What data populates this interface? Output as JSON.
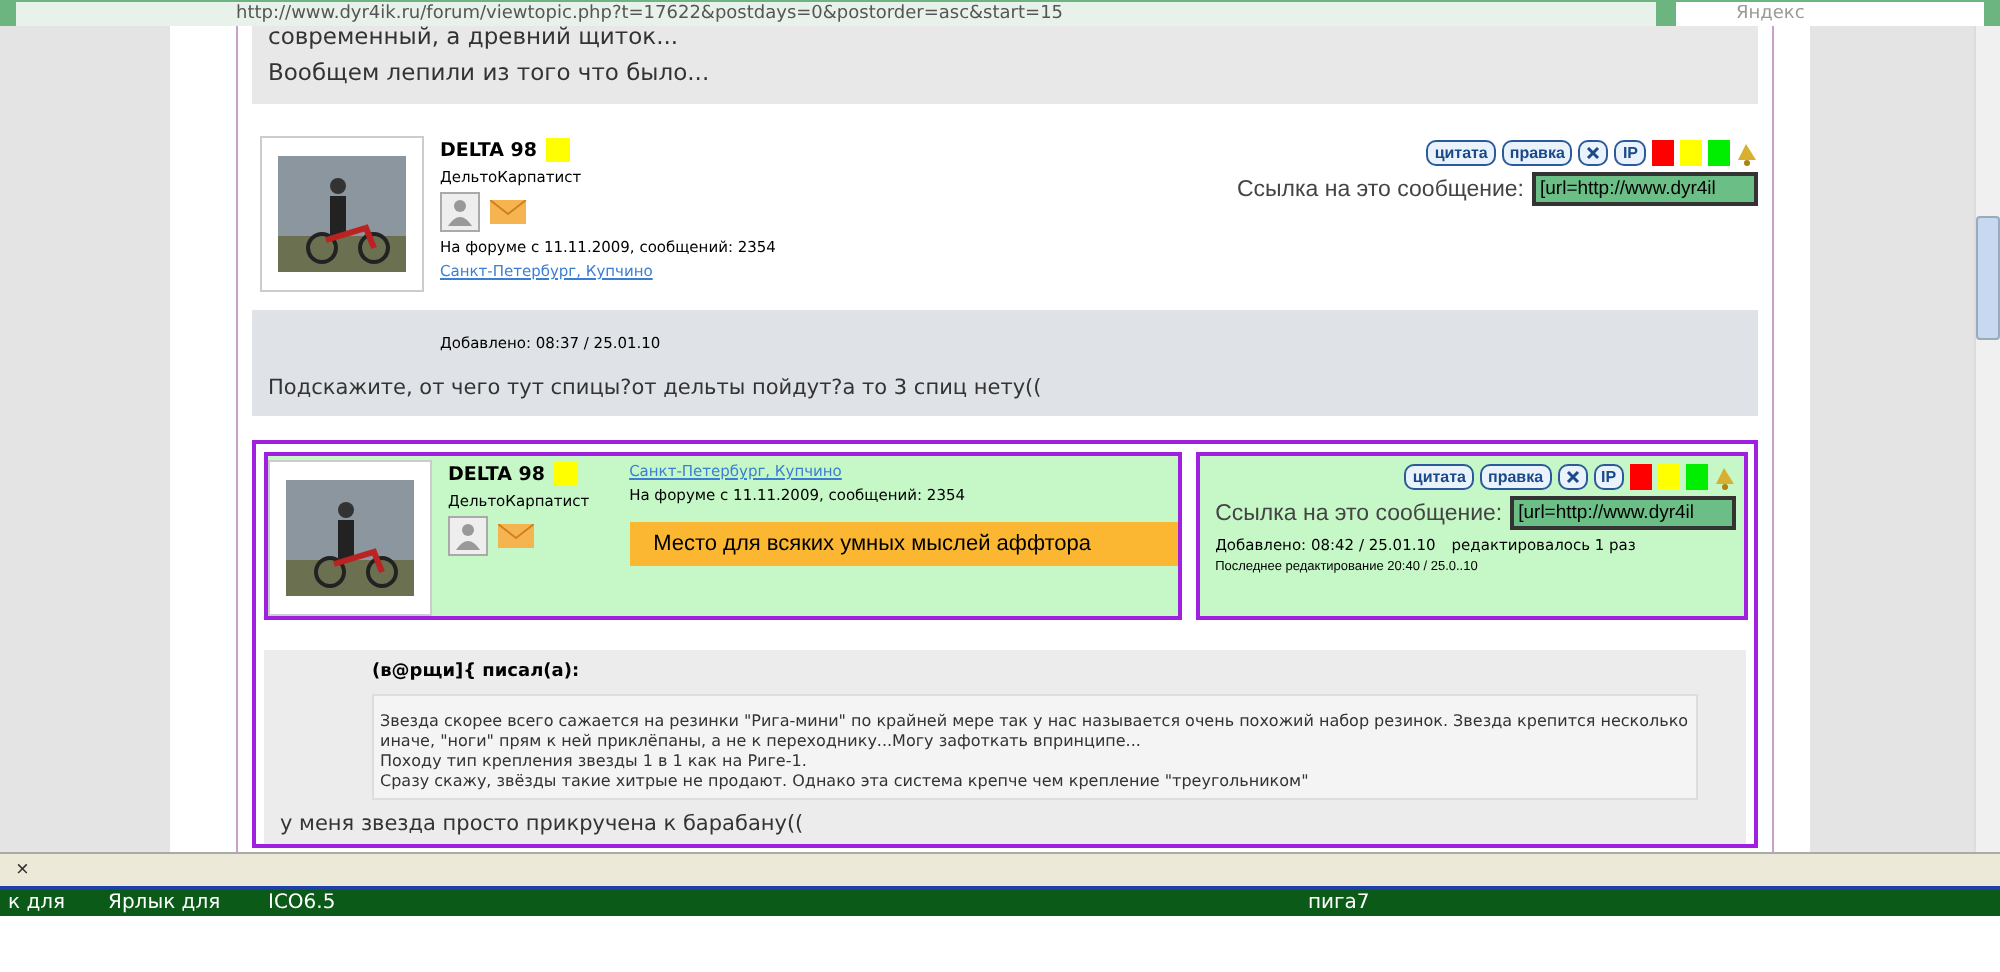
{
  "browser": {
    "url": "http://www.dyr4ik.ru/forum/viewtopic.php?t=17622&postdays=0&postorder=asc&start=15",
    "search_placeholder": "Яндекс"
  },
  "previous_post": {
    "lines": [
      "современный, а древний щиток...",
      "Вообщем лепили из того что было..."
    ]
  },
  "posts": [
    {
      "kind": "plain",
      "author": "DELTA 98",
      "color": "#ffff00",
      "rank": "ДельтоКарпатист",
      "joined": "На форуме с 11.11.2009, сообщений: 2354",
      "location": "Санкт-Петербург, Купчино",
      "actions": [
        "цитата",
        "правка"
      ],
      "icon_buttons": [
        "IP"
      ],
      "ratings": [
        {
          "color": "#ff0000"
        },
        {
          "color": "#ffff00"
        },
        {
          "color": "#00ee00"
        }
      ],
      "link_label": "Ссылка на это сообщение:",
      "link_value": "[url=http://www.dyr4il",
      "added": "Добавлено: 08:37 / 25.01.10",
      "message": "Подскажите, от чего тут спицы?от дельты пойдут?а то 3 спиц нету(("
    },
    {
      "kind": "highlighted",
      "author": "DELTA 98",
      "color": "#ffff00",
      "rank": "ДельтоКарпатист",
      "joined": "На форуме с 11.11.2009, сообщений: 2354",
      "location": "Санкт-Петербург, Купчино",
      "note": "Место для всяких умных мыслей аффтора",
      "actions": [
        "цитата",
        "правка"
      ],
      "icon_buttons": [
        "IP"
      ],
      "ratings": [
        {
          "color": "#ff0000"
        },
        {
          "color": "#ffff00"
        },
        {
          "color": "#00ee00"
        }
      ],
      "link_label": "Ссылка на это сообщение:",
      "link_value": "[url=http://www.dyr4il",
      "added": "Добавлено: 08:42 / 25.01.10",
      "edited": "редактировалось 1 раз",
      "last_edit": "Последнее редактирование 20:40 / 25.0..10",
      "quote": {
        "author": "(в@рщи]{ писал(а):",
        "lines": [
          "Звезда скорее всего сажается на резинки \"Рига-мини\" по крайней мере так у нас называется очень похожий набор резинок. Звезда крепится несколько иначе, \"ноги\" прям к ней приклёпаны, а не к переходнику...Могу зафоткать впринципе...",
          "Походу тип крепления звезды 1 в 1 как на Риге-1.",
          "Сразу скажу, звёзды такие хитрые не продают. Однако эта система крепче чем крепление \"треугольником\""
        ]
      },
      "message": "у меня звезда просто прикручена к барабану(("
    }
  ],
  "find_bar": {
    "close": "×"
  },
  "taskbar": [
    "к для",
    "Ярлык для",
    "ICO6.5",
    "пига7"
  ]
}
